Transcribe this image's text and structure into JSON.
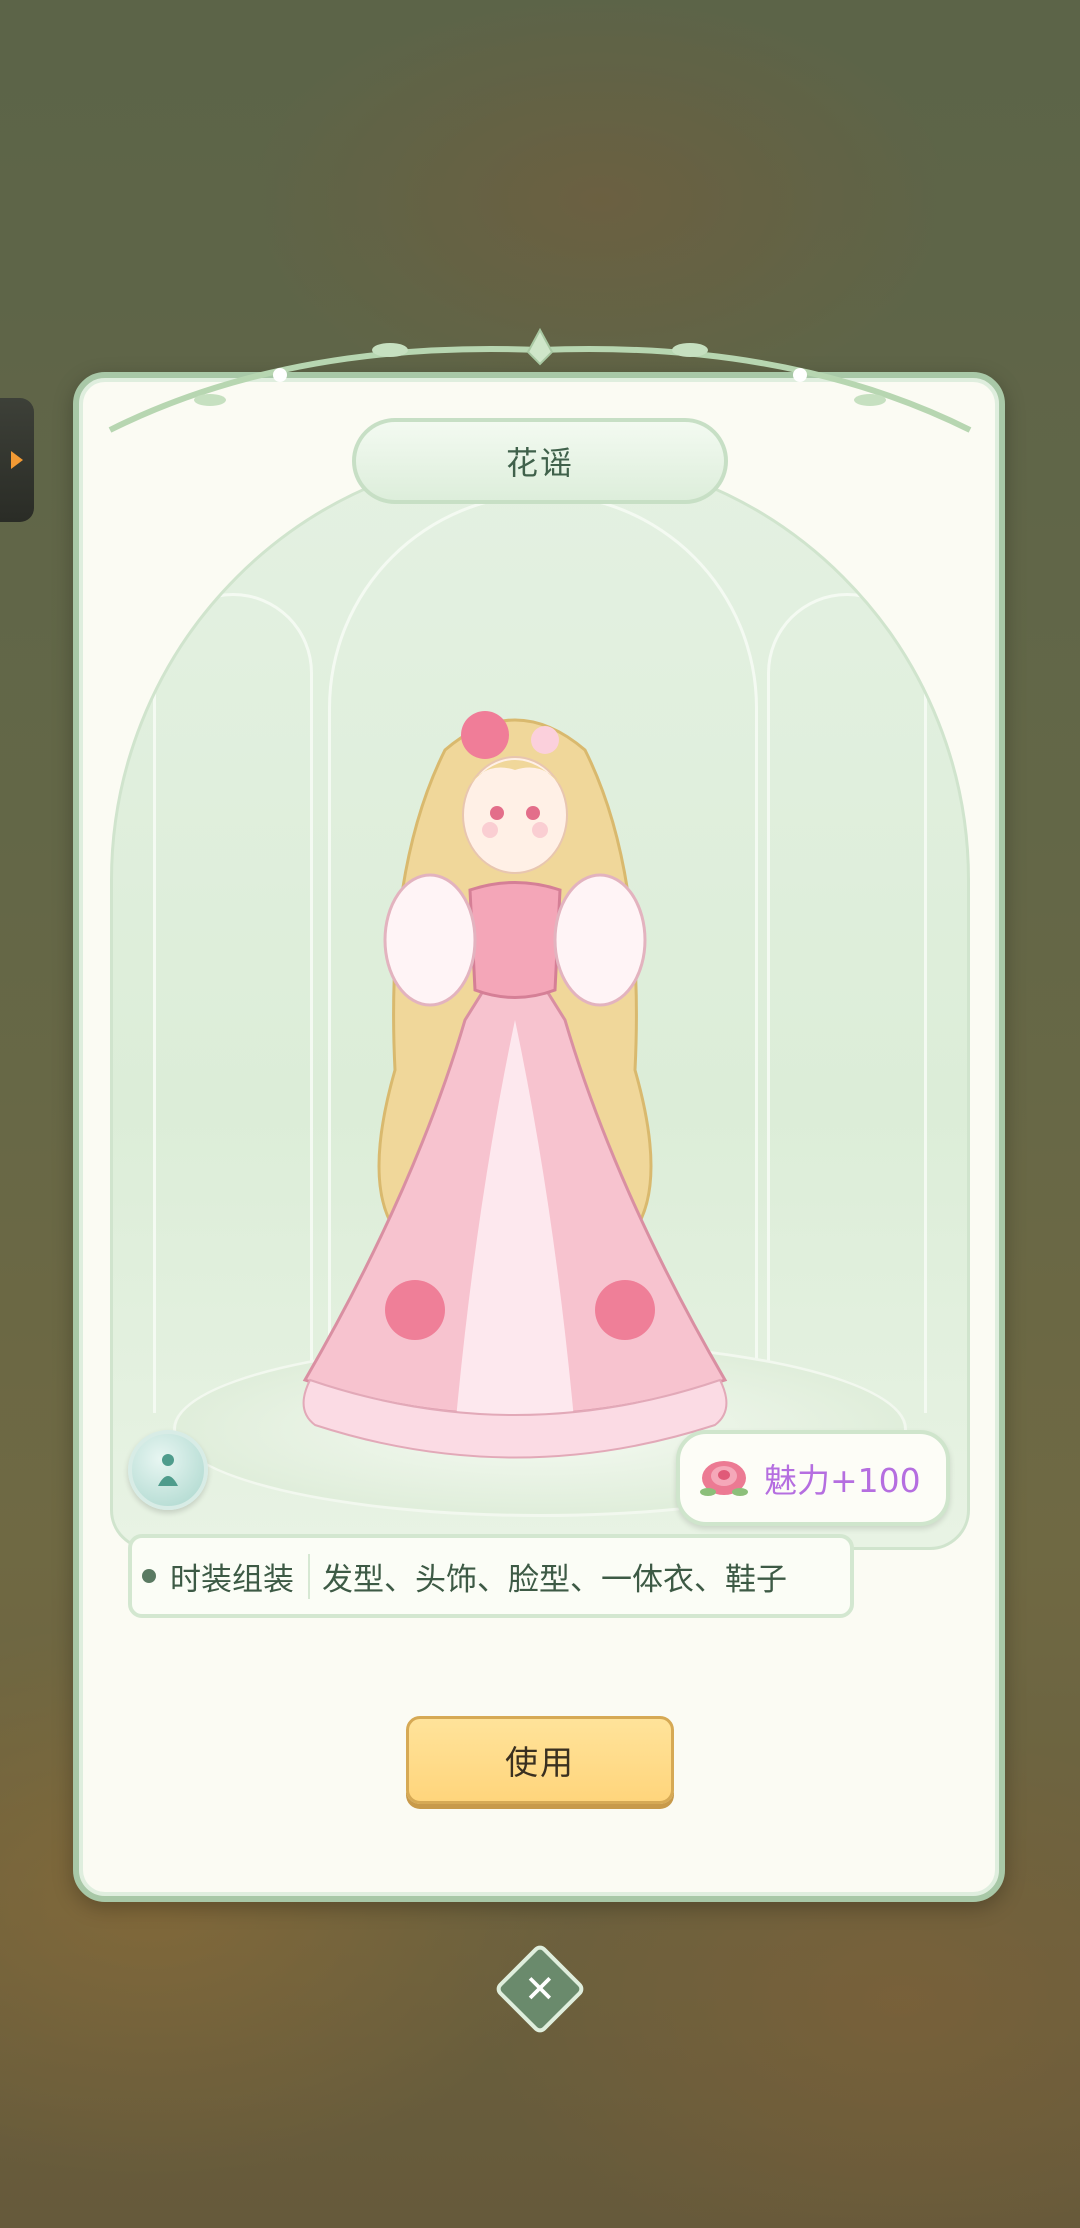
{
  "outfit": {
    "name": "花谣",
    "charm": "魅力+100",
    "assembly_label": "时装组装",
    "assembly_parts": "发型、头饰、脸型、一体衣、鞋子"
  },
  "actions": {
    "use_label": "使用",
    "close_symbol": "✕"
  },
  "icons": {
    "side_tab": "expand-arrow-icon",
    "pose": "pose-icon",
    "charm": "rose-icon",
    "close": "close-icon"
  },
  "colors": {
    "card_border": "#a8c8a7",
    "charm_text": "#b56ee0",
    "use_button": "#ffd57c"
  }
}
